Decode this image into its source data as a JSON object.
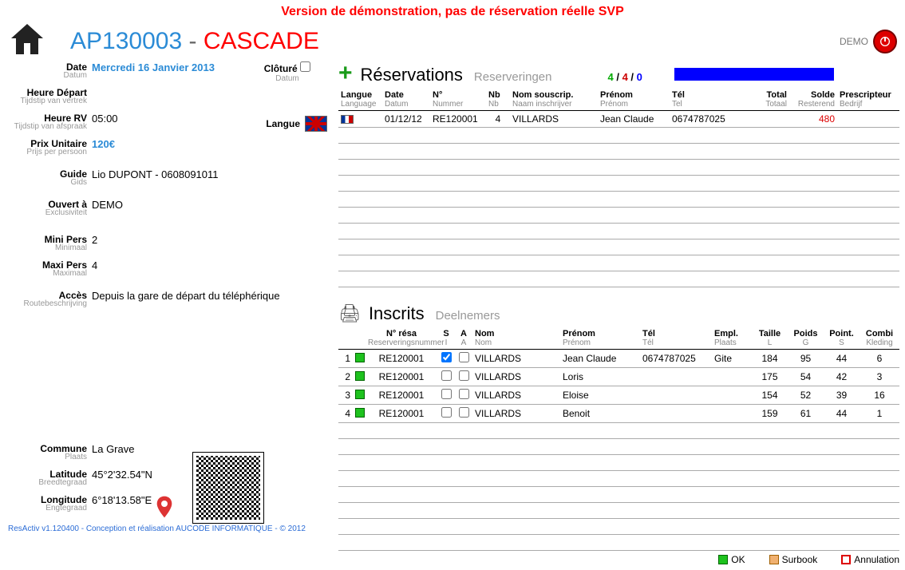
{
  "banner": "Version de démonstration, pas de réservation réelle SVP",
  "demo_label": "DEMO",
  "title": {
    "code": "AP130003",
    "dash": " - ",
    "name": "CASCADE"
  },
  "left": {
    "date": {
      "fr": "Date",
      "nl": "Datum",
      "value": "Mercredi 16 Janvier 2013"
    },
    "cloture": {
      "fr": "Clôturé",
      "nl": "Datum"
    },
    "heure_depart": {
      "fr": "Heure Départ",
      "nl": "Tijdstip van vertrek",
      "value": ""
    },
    "heure_rv": {
      "fr": "Heure RV",
      "nl": "Tijdstip van afspraak",
      "value": "05:00"
    },
    "langue": {
      "fr": "Langue"
    },
    "prix": {
      "fr": "Prix Unitaire",
      "nl": "Prijs per persoon",
      "value": "120€"
    },
    "guide": {
      "fr": "Guide",
      "nl": "Gids",
      "value": "Lio DUPONT - 0608091011"
    },
    "ouvert": {
      "fr": "Ouvert à",
      "nl": "Exclusiviteit",
      "value": "DEMO"
    },
    "mini": {
      "fr": "Mini Pers",
      "nl": "Minimaal",
      "value": "2"
    },
    "maxi": {
      "fr": "Maxi Pers",
      "nl": "Maximaal",
      "value": "4"
    },
    "acces": {
      "fr": "Accès",
      "nl": "Routebeschrijving",
      "value": "Depuis la gare de départ du téléphérique"
    },
    "commune": {
      "fr": "Commune",
      "nl": "Plaats",
      "value": "La Grave"
    },
    "latitude": {
      "fr": "Latitude",
      "nl": "Breedtegraad",
      "value": "45°2'32.54\"N"
    },
    "longitude": {
      "fr": "Longitude",
      "nl": "Engtegraad",
      "value": "6°18'13.58\"E"
    }
  },
  "reservations": {
    "title": "Réservations",
    "sub": "Reserveringen",
    "counts": {
      "a": "4",
      "b": "4",
      "c": "0"
    },
    "cols": {
      "langue": {
        "fr": "Langue",
        "nl": "Language"
      },
      "date": {
        "fr": "Date",
        "nl": "Datum"
      },
      "num": {
        "fr": "N°",
        "nl": "Nummer"
      },
      "nb": {
        "fr": "Nb",
        "nl": "Nb"
      },
      "nom": {
        "fr": "Nom souscrip.",
        "nl": "Naam inschrijver"
      },
      "prenom": {
        "fr": "Prénom",
        "nl": "Prénom"
      },
      "tel": {
        "fr": "Tél",
        "nl": "Tel"
      },
      "total": {
        "fr": "Total",
        "nl": "Totaal"
      },
      "solde": {
        "fr": "Solde",
        "nl": "Resterend"
      },
      "presc": {
        "fr": "Prescripteur",
        "nl": "Bedrijf"
      }
    },
    "rows": [
      {
        "date": "01/12/12",
        "num": "RE120001",
        "nb": "4",
        "nom": "VILLARDS",
        "prenom": "Jean Claude",
        "tel": "0674787025",
        "total": "",
        "solde": "480",
        "presc": ""
      }
    ]
  },
  "inscrits": {
    "title": "Inscrits",
    "sub": "Deelnemers",
    "cols": {
      "resa": {
        "fr": "N° résa",
        "nl": "Reserveringsnummer"
      },
      "s": {
        "fr": "S",
        "nl": "I"
      },
      "a": {
        "fr": "A",
        "nl": "A"
      },
      "nom": {
        "fr": "Nom",
        "nl": "Nom"
      },
      "prenom": {
        "fr": "Prénom",
        "nl": "Prénom"
      },
      "tel": {
        "fr": "Tél",
        "nl": "Tél"
      },
      "empl": {
        "fr": "Empl.",
        "nl": "Plaats"
      },
      "taille": {
        "fr": "Taille",
        "nl": "L"
      },
      "poids": {
        "fr": "Poids",
        "nl": "G"
      },
      "point": {
        "fr": "Point.",
        "nl": "S"
      },
      "combi": {
        "fr": "Combi",
        "nl": "Kleding"
      }
    },
    "rows": [
      {
        "idx": "1",
        "resa": "RE120001",
        "s": true,
        "a": false,
        "nom": "VILLARDS",
        "prenom": "Jean Claude",
        "tel": "0674787025",
        "empl": "Gite",
        "taille": "184",
        "poids": "95",
        "point": "44",
        "combi": "6"
      },
      {
        "idx": "2",
        "resa": "RE120001",
        "s": false,
        "a": false,
        "nom": "VILLARDS",
        "prenom": "Loris",
        "tel": "",
        "empl": "",
        "taille": "175",
        "poids": "54",
        "point": "42",
        "combi": "3"
      },
      {
        "idx": "3",
        "resa": "RE120001",
        "s": false,
        "a": false,
        "nom": "VILLARDS",
        "prenom": "Eloise",
        "tel": "",
        "empl": "",
        "taille": "154",
        "poids": "52",
        "point": "39",
        "combi": "16"
      },
      {
        "idx": "4",
        "resa": "RE120001",
        "s": false,
        "a": false,
        "nom": "VILLARDS",
        "prenom": "Benoit",
        "tel": "",
        "empl": "",
        "taille": "159",
        "poids": "61",
        "point": "44",
        "combi": "1"
      }
    ]
  },
  "legend": {
    "ok": "OK",
    "surbook": "Surbook",
    "annul": "Annulation"
  },
  "footer": "ResActiv v1.120400 - Conception et réalisation AUCODE INFORMATIQUE - © 2012"
}
